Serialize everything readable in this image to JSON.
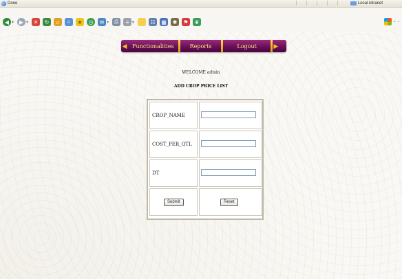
{
  "status_bar": {
    "left_text": "Done",
    "zone_text": "Local intranet"
  },
  "navbar": {
    "items": [
      "Functionalities",
      "Reports",
      "Logout"
    ]
  },
  "welcome_text": "WELCOME admin",
  "heading": "ADD CROP PRICE LIST",
  "form": {
    "fields": [
      {
        "label": "CROP_NAME",
        "value": ""
      },
      {
        "label": "COST_PER_QTL",
        "value": ""
      },
      {
        "label": "DT",
        "value": ""
      }
    ],
    "submit_label": "Submit",
    "reset_label": "Reset"
  },
  "colors": {
    "nav_bg": "#6a0f5a",
    "nav_text": "#ffe97a",
    "accent_gold": "#f2c01a"
  }
}
